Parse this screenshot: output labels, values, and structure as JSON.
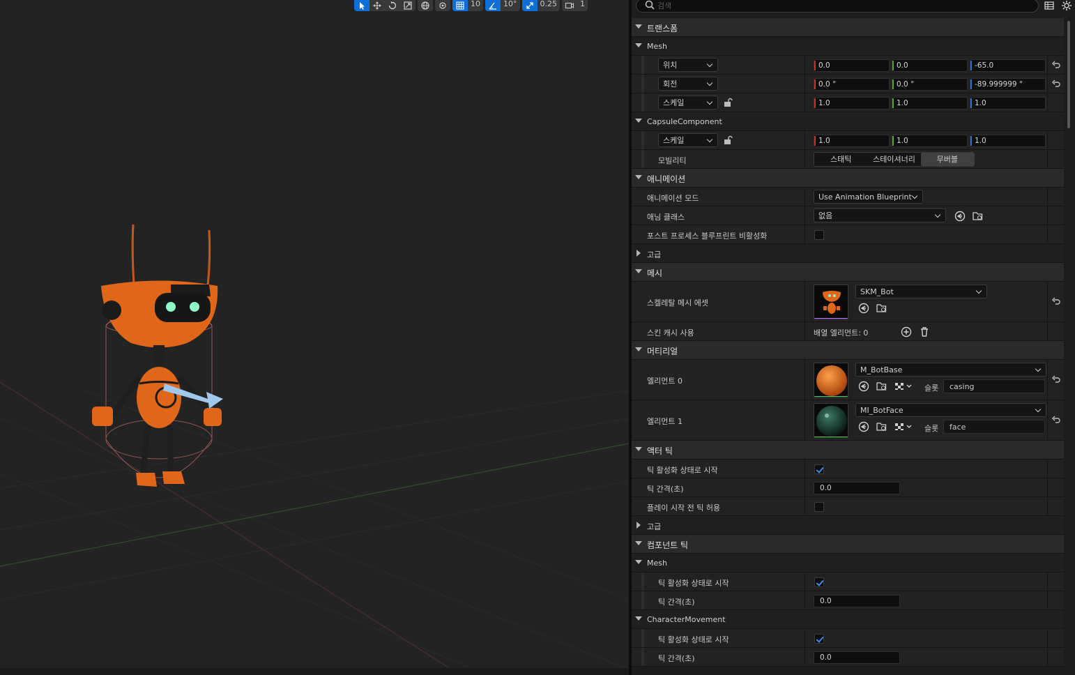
{
  "viewport_toolbar": {
    "grid_snap": "10",
    "rotation_snap": "10°",
    "scale_snap": "0.25",
    "camera_speed": "1"
  },
  "details": {
    "search": {
      "placeholder": "검색",
      "value": ""
    },
    "transform": {
      "category": "트랜스폼",
      "mesh": {
        "label": "Mesh",
        "location": {
          "label": "위치",
          "x": "0.0",
          "y": "0.0",
          "z": "-65.0"
        },
        "rotation": {
          "label": "회전",
          "x": "0.0 °",
          "y": "0.0 °",
          "z": "-89.999999 °"
        },
        "scale": {
          "label": "스케일",
          "x": "1.0",
          "y": "1.0",
          "z": "1.0"
        }
      },
      "capsule": {
        "label": "CapsuleComponent",
        "scale": {
          "label": "스케일",
          "x": "1.0",
          "y": "1.0",
          "z": "1.0"
        },
        "mobility": {
          "label": "모빌리티",
          "options": [
            "스태틱",
            "스테이셔너리",
            "무버블"
          ],
          "selected": "무버블"
        }
      }
    },
    "animation": {
      "category": "애니메이션",
      "mode": {
        "label": "애니메이션 모드",
        "value": "Use Animation Blueprint"
      },
      "anim_class": {
        "label": "애님 클래스",
        "value": "없음"
      },
      "disable_post_process": {
        "label": "포스트 프로세스 블루프린트 비활성화",
        "checked": false
      },
      "advanced": "고급"
    },
    "mesh": {
      "category": "메시",
      "skeletal_mesh": {
        "label": "스켈레탈 메시 에셋",
        "value": "SKM_Bot"
      },
      "skin_cache": {
        "label": "스킨 캐시 사용",
        "value": "배열 엘리먼트: 0"
      }
    },
    "materials": {
      "category": "머티리얼",
      "elements": [
        {
          "label": "엘리먼트 0",
          "value": "M_BotBase",
          "slot_label": "슬롯",
          "slot": "casing",
          "swatch": "#e8711c"
        },
        {
          "label": "엘리먼트 1",
          "value": "MI_BotFace",
          "slot_label": "슬롯",
          "slot": "face",
          "swatch": "#1f4a3a"
        }
      ]
    },
    "actor_tick": {
      "category": "액터 틱",
      "start_enabled": {
        "label": "틱 활성화 상태로 시작",
        "checked": true
      },
      "interval": {
        "label": "틱 간격(초)",
        "value": "0.0"
      },
      "allow_before_play": {
        "label": "플레이 시작 전 틱 허용",
        "checked": false
      },
      "advanced": "고급"
    },
    "component_tick": {
      "category": "컴포넌트 틱",
      "mesh": {
        "label": "Mesh",
        "start_enabled": {
          "label": "틱 활성화 상태로 시작",
          "checked": true
        },
        "interval": {
          "label": "틱 간격(초)",
          "value": "0.0"
        }
      },
      "character_movement": {
        "label": "CharacterMovement",
        "start_enabled": {
          "label": "틱 활성화 상태로 시작",
          "checked": true
        },
        "interval": {
          "label": "틱 간격(초)",
          "value": "0.0"
        }
      }
    }
  },
  "colors": {
    "accent": "#0f6fd6",
    "axis_x": "#c8321e",
    "axis_y": "#5aa02a",
    "axis_z": "#2c6fd6"
  }
}
